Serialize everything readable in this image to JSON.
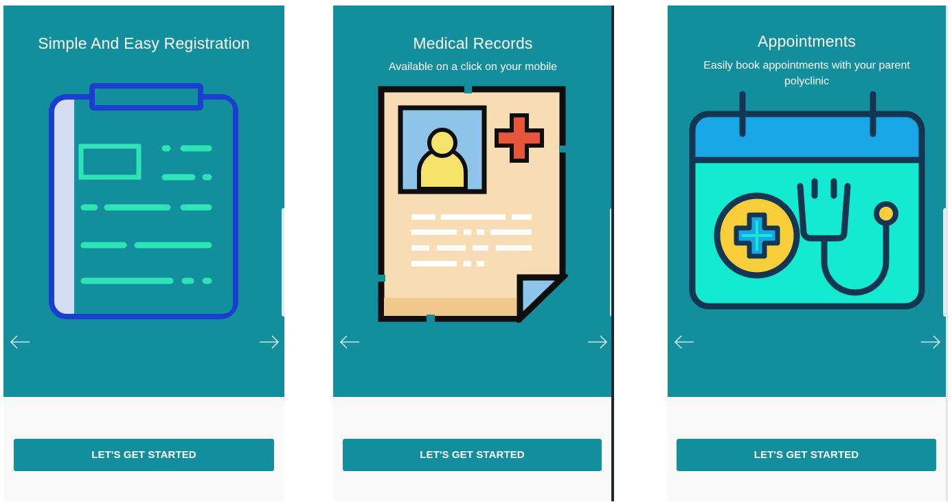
{
  "screens": [
    {
      "title": "Simple And Easy Registration",
      "subtitle": "",
      "illustration": "clipboard-icon",
      "cta_label": "LET'S GET STARTED",
      "prev_icon": "arrow-left-icon",
      "next_icon": "arrow-right-icon"
    },
    {
      "title": "Medical Records",
      "subtitle": "Available on a click on your mobile",
      "illustration": "medical-record-icon",
      "cta_label": "LET'S GET STARTED",
      "prev_icon": "arrow-left-icon",
      "next_icon": "arrow-right-icon"
    },
    {
      "title": "Appointments",
      "subtitle": "Easily book appointments with your parent polyclinic",
      "illustration": "calendar-stethoscope-icon",
      "cta_label": "LET'S GET STARTED",
      "prev_icon": "arrow-left-icon",
      "next_icon": "arrow-right-icon"
    }
  ],
  "colors": {
    "teal": "#128e9c",
    "footer": "#f8f8f8",
    "white": "#ffffff"
  }
}
